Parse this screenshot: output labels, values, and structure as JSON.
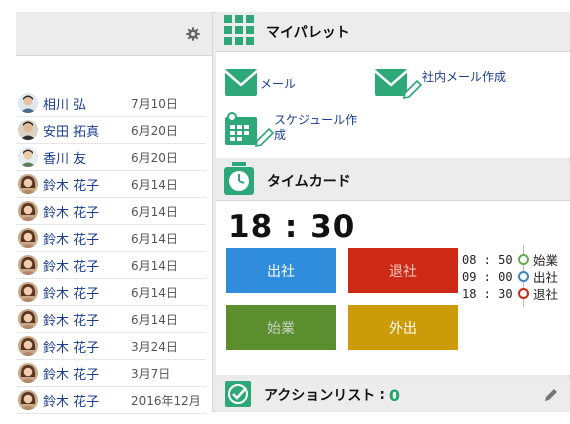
{
  "colors": {
    "accent_green": "#2ea779",
    "btn_shussha": "#2f8ddb",
    "btn_taisha": "#cc2a17",
    "btn_shigyo": "#5a8e2f",
    "btn_gaishutsu": "#cc9b08",
    "name_link": "#1a3d8f"
  },
  "left_panel": {
    "header_icon": "gear-icon",
    "rows": [
      {
        "name": "相川 弘",
        "date": "7月10日",
        "avatar": "male-1"
      },
      {
        "name": "安田 拓真",
        "date": "6月20日",
        "avatar": "male-2"
      },
      {
        "name": "香川 友",
        "date": "6月20日",
        "avatar": "male-3"
      },
      {
        "name": "鈴木 花子",
        "date": "6月14日",
        "avatar": "female"
      },
      {
        "name": "鈴木 花子",
        "date": "6月14日",
        "avatar": "female"
      },
      {
        "name": "鈴木 花子",
        "date": "6月14日",
        "avatar": "female"
      },
      {
        "name": "鈴木 花子",
        "date": "6月14日",
        "avatar": "female"
      },
      {
        "name": "鈴木 花子",
        "date": "6月14日",
        "avatar": "female"
      },
      {
        "name": "鈴木 花子",
        "date": "6月14日",
        "avatar": "female"
      },
      {
        "name": "鈴木 花子",
        "date": "3月24日",
        "avatar": "female"
      },
      {
        "name": "鈴木 花子",
        "date": "3月7日",
        "avatar": "female"
      },
      {
        "name": "鈴木 花子",
        "date": "2016年12月",
        "avatar": "female"
      }
    ]
  },
  "my_palette": {
    "title": "マイパレット",
    "icon": "grid-icon",
    "items": [
      {
        "label": "メール",
        "icon": "mail-icon"
      },
      {
        "label": "社内メール作成",
        "icon": "mail-compose-icon"
      },
      {
        "label_line1": "スケジュール作",
        "label_line2": "成",
        "icon": "schedule-create-icon"
      }
    ]
  },
  "time_card": {
    "title": "タイムカード",
    "icon": "timer-icon",
    "current_time": "18 : 30",
    "buttons": {
      "shussha": "出社",
      "taisha": "退社",
      "shigyo": "始業",
      "gaishutsu": "外出"
    },
    "log": [
      {
        "time": "08 : 50",
        "label": "始業",
        "color": "#6aa84f"
      },
      {
        "time": "09 : 00",
        "label": "出社",
        "color": "#3d85c6"
      },
      {
        "time": "18 : 30",
        "label": "退社",
        "color": "#cc2a17"
      }
    ]
  },
  "action_list": {
    "title": "アクションリスト",
    "separator": ":",
    "count": "0",
    "icon": "checkbox-icon",
    "edit_icon": "pencil-icon"
  }
}
